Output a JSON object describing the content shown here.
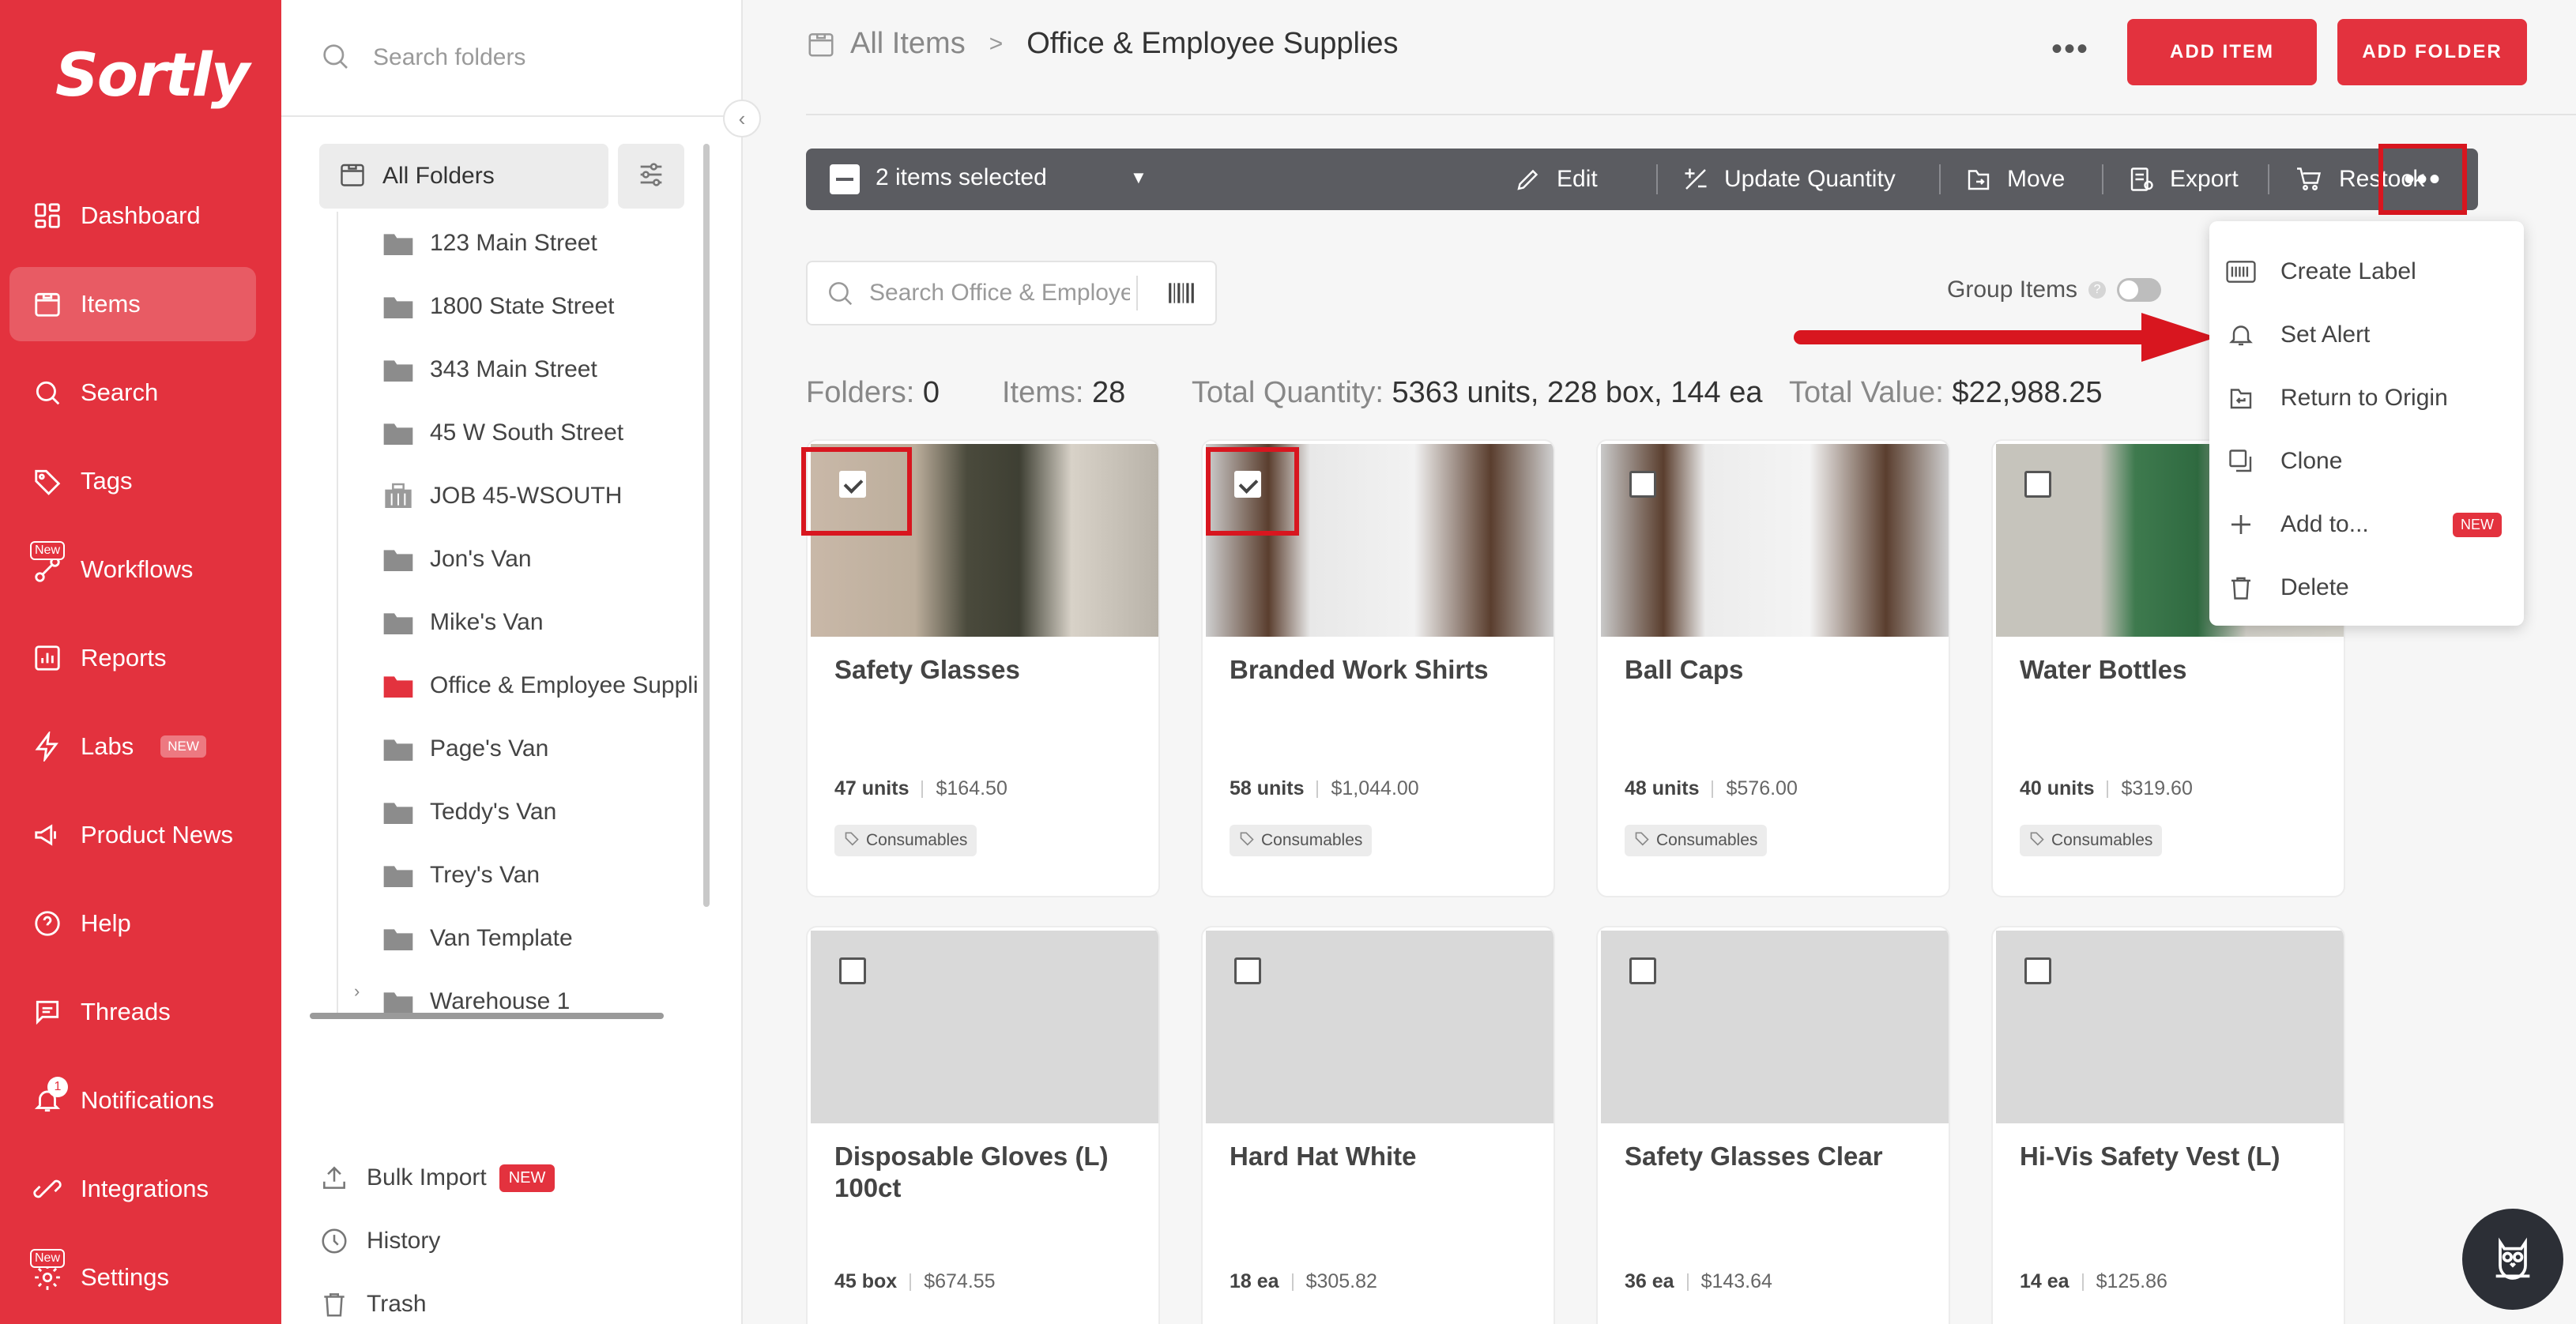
{
  "brand": {
    "name": "Sortly",
    "accent": "#e3323e"
  },
  "nav": {
    "items": [
      {
        "label": "Dashboard",
        "icon": "dashboard-icon"
      },
      {
        "label": "Items",
        "icon": "items-icon",
        "active": true
      },
      {
        "label": "Search",
        "icon": "search-icon"
      },
      {
        "label": "Tags",
        "icon": "tag-icon"
      },
      {
        "label": "Workflows",
        "icon": "workflows-icon",
        "badge": "New"
      },
      {
        "label": "Reports",
        "icon": "reports-icon"
      },
      {
        "label": "Labs",
        "icon": "bolt-icon",
        "pill": "NEW"
      },
      {
        "label": "Product News",
        "icon": "megaphone-icon"
      },
      {
        "label": "Help",
        "icon": "help-icon"
      },
      {
        "label": "Threads",
        "icon": "threads-icon"
      },
      {
        "label": "Notifications",
        "icon": "bell-icon",
        "count": "1"
      },
      {
        "label": "Integrations",
        "icon": "integrations-icon"
      },
      {
        "label": "Settings",
        "icon": "gear-icon",
        "badge": "New"
      }
    ]
  },
  "folders": {
    "search_placeholder": "Search folders",
    "all_folders": "All Folders",
    "items": [
      {
        "label": "123 Main Street",
        "kind": "folder"
      },
      {
        "label": "1800 State Street",
        "kind": "folder"
      },
      {
        "label": "343 Main Street",
        "kind": "folder"
      },
      {
        "label": "45 W South Street",
        "kind": "folder"
      },
      {
        "label": "JOB 45-WSOUTH",
        "kind": "building"
      },
      {
        "label": "Jon's Van",
        "kind": "folder"
      },
      {
        "label": "Mike's Van",
        "kind": "folder"
      },
      {
        "label": "Office & Employee Suppli",
        "kind": "folder",
        "active": true
      },
      {
        "label": "Page's Van",
        "kind": "folder"
      },
      {
        "label": "Teddy's Van",
        "kind": "folder"
      },
      {
        "label": "Trey's Van",
        "kind": "folder"
      },
      {
        "label": "Van Template",
        "kind": "folder"
      },
      {
        "label": "Warehouse 1",
        "kind": "folder",
        "expandable": true
      }
    ],
    "bottom": {
      "bulk_import": "Bulk Import",
      "bulk_import_tag": "NEW",
      "history": "History",
      "trash": "Trash"
    }
  },
  "header": {
    "breadcrumb_root": "All Items",
    "breadcrumb_sep": ">",
    "breadcrumb_current": "Office & Employee Supplies",
    "more": "•••",
    "add_item": "ADD ITEM",
    "add_folder": "ADD FOLDER"
  },
  "actionbar": {
    "selected": "2 items selected",
    "edit": "Edit",
    "update_quantity": "Update Quantity",
    "move": "Move",
    "export": "Export",
    "restock": "Restock",
    "more": "•••"
  },
  "toolbar": {
    "search_placeholder": "Search Office & Employee Supplies",
    "group_items": "Group Items",
    "help": "?"
  },
  "stats": {
    "folders_label": "Folders:",
    "folders_value": "0",
    "items_label": "Items:",
    "items_value": "28",
    "qty_label": "Total Quantity:",
    "qty_value": "5363 units, 228 box, 144 ea",
    "value_label": "Total Value:",
    "value_value": "$22,988.25"
  },
  "menu": {
    "items": [
      {
        "label": "Create Label",
        "icon": "barcode-icon"
      },
      {
        "label": "Set Alert",
        "icon": "bell-icon"
      },
      {
        "label": "Return to Origin",
        "icon": "return-icon"
      },
      {
        "label": "Clone",
        "icon": "clone-icon"
      },
      {
        "label": "Add to...",
        "icon": "plus-icon",
        "tag": "NEW"
      },
      {
        "label": "Delete",
        "icon": "trash-icon"
      }
    ]
  },
  "cards": [
    {
      "name": "Safety Glasses",
      "qty": "47 units",
      "price": "$164.50",
      "tag": "Consumables",
      "checked": true
    },
    {
      "name": "Branded Work Shirts",
      "qty": "58 units",
      "price": "$1,044.00",
      "tag": "Consumables",
      "checked": true
    },
    {
      "name": "Ball Caps",
      "qty": "48 units",
      "price": "$576.00",
      "tag": "Consumables",
      "checked": false
    },
    {
      "name": "Water Bottles",
      "qty": "40 units",
      "price": "$319.60",
      "tag": "Consumables",
      "checked": false
    },
    {
      "name": "Disposable Gloves (L) 100ct",
      "qty": "45 box",
      "price": "$674.55",
      "checked": false
    },
    {
      "name": "Hard Hat White",
      "qty": "18 ea",
      "price": "$305.82",
      "checked": false
    },
    {
      "name": "Safety Glasses Clear",
      "qty": "36 ea",
      "price": "$143.64",
      "checked": false
    },
    {
      "name": "Hi-Vis Safety Vest (L)",
      "qty": "14 ea",
      "price": "$125.86",
      "checked": false
    }
  ]
}
